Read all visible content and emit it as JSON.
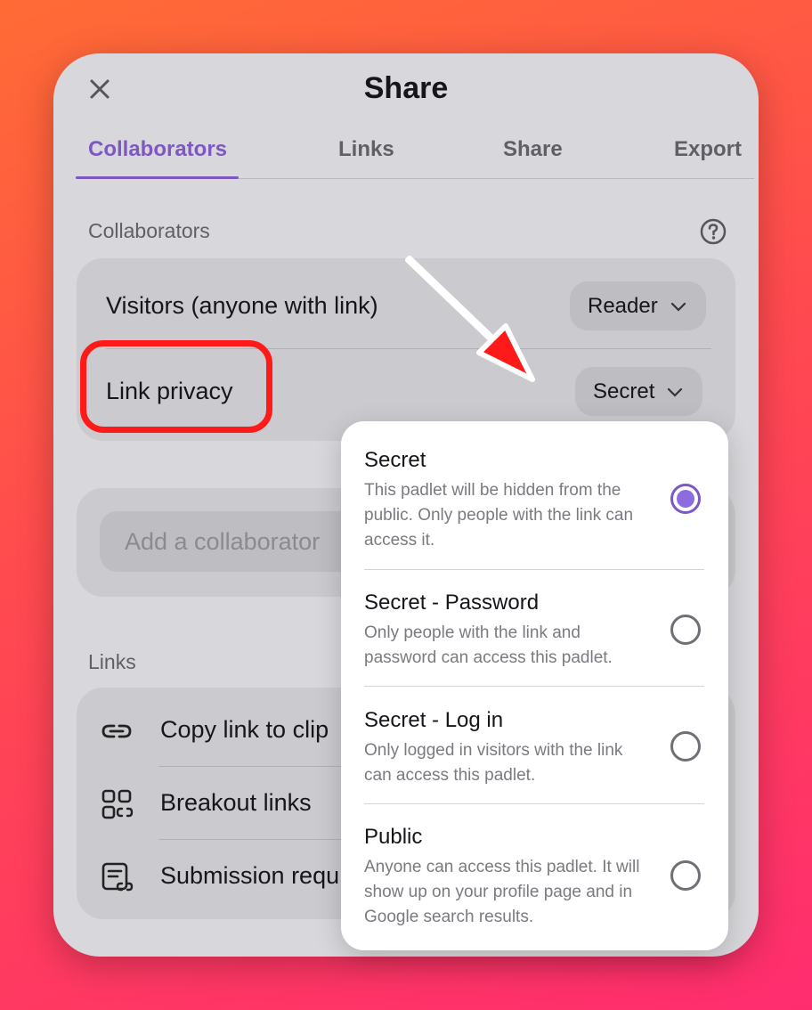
{
  "dialog": {
    "title": "Share"
  },
  "tabs": [
    "Collaborators",
    "Links",
    "Share",
    "Export"
  ],
  "collaborators": {
    "section_label": "Collaborators",
    "visitors_label": "Visitors (anyone with link)",
    "visitors_value": "Reader",
    "privacy_label": "Link privacy",
    "privacy_value": "Secret",
    "add_placeholder": "Add a collaborator"
  },
  "links": {
    "section_label": "Links",
    "items": [
      "Copy link to clip",
      "Breakout links",
      "Submission requ"
    ]
  },
  "privacy_dropdown": {
    "options": [
      {
        "title": "Secret",
        "desc": "This padlet will be hidden from the public. Only people with the link can access it.",
        "selected": true
      },
      {
        "title": "Secret - Password",
        "desc": "Only people with the link and password can access this padlet.",
        "selected": false
      },
      {
        "title": "Secret - Log in",
        "desc": "Only logged in visitors with the link can access this padlet.",
        "selected": false
      },
      {
        "title": "Public",
        "desc": "Anyone can access this padlet. It will show up on your profile page and in Google search results.",
        "selected": false
      }
    ]
  },
  "colors": {
    "accent": "#7e57c2",
    "annotation": "#ff1a1a"
  }
}
